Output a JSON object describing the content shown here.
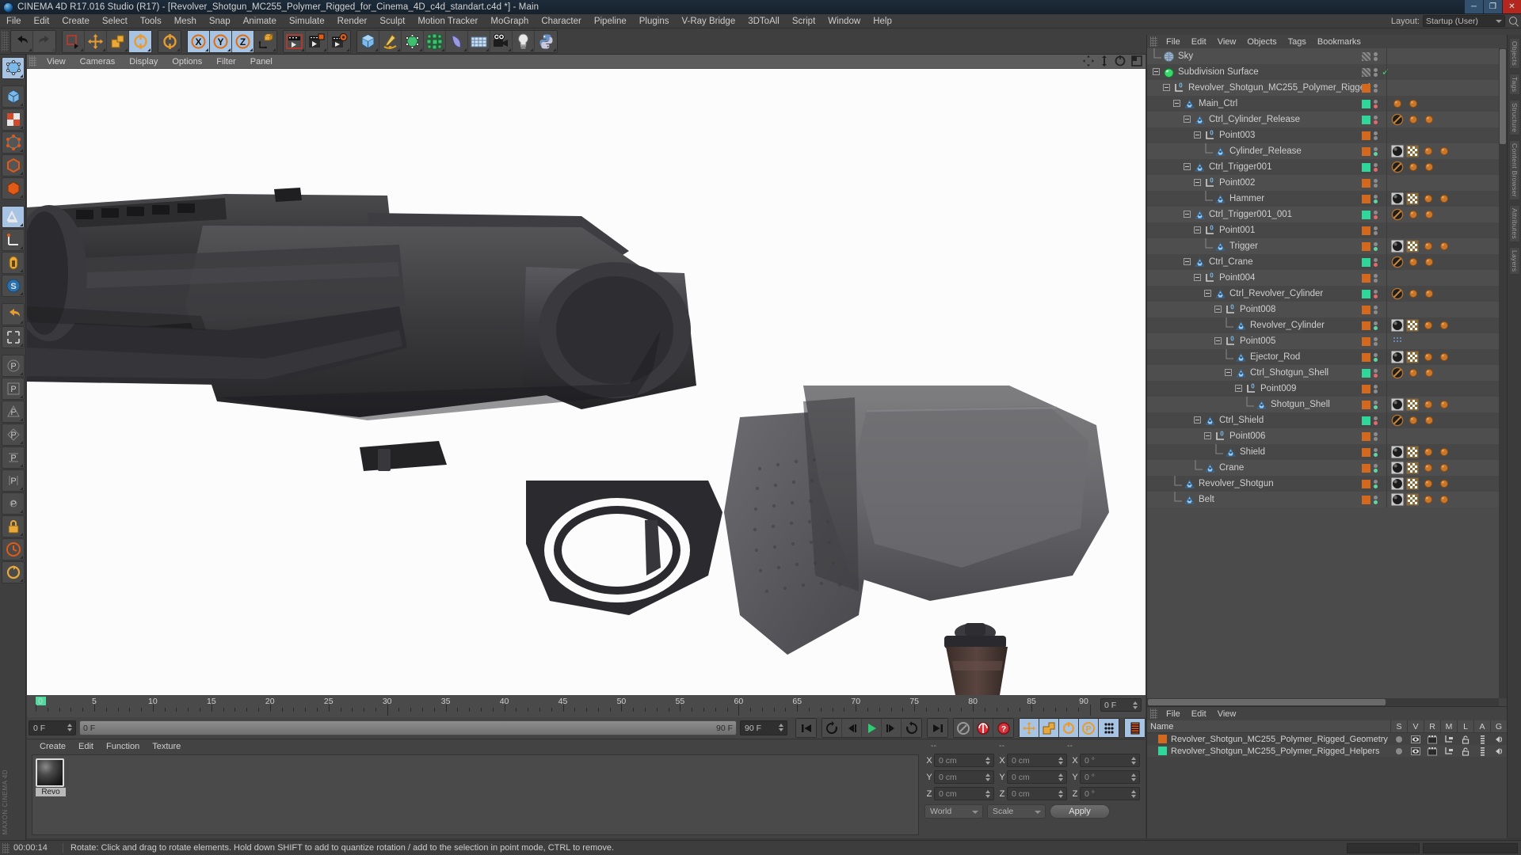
{
  "window": {
    "title": "CINEMA 4D R17.016 Studio (R17) - [Revolver_Shotgun_MC255_Polymer_Rigged_for_Cinema_4D_c4d_standart.c4d *] - Main",
    "minimize": "─",
    "maximize": "❐",
    "close": "✕"
  },
  "menubar": {
    "items": [
      "File",
      "Edit",
      "Create",
      "Select",
      "Tools",
      "Mesh",
      "Snap",
      "Animate",
      "Simulate",
      "Render",
      "Sculpt",
      "Motion Tracker",
      "MoGraph",
      "Character",
      "Pipeline",
      "Plugins",
      "V-Ray Bridge",
      "3DToAll",
      "Script",
      "Window",
      "Help"
    ],
    "layout_label": "Layout:",
    "layout_value": "Startup (User)"
  },
  "toolbar": {
    "groups": [
      {
        "buttons": [
          {
            "name": "undo-button",
            "icon": "undo",
            "state": "normal"
          },
          {
            "name": "redo-button",
            "icon": "redo",
            "state": "dim"
          }
        ]
      },
      {
        "buttons": [
          {
            "name": "live-selection-button",
            "icon": "select",
            "state": "normal"
          },
          {
            "name": "move-button",
            "icon": "move",
            "state": "normal"
          },
          {
            "name": "scale-button",
            "icon": "scale",
            "state": "normal"
          },
          {
            "name": "rotate-button",
            "icon": "rotate",
            "state": "active"
          }
        ]
      },
      {
        "buttons": [
          {
            "name": "rotate-alt-button",
            "icon": "rotate",
            "state": "normal"
          }
        ]
      },
      {
        "buttons": [
          {
            "name": "x-axis-lock-button",
            "icon": "x",
            "state": "active"
          },
          {
            "name": "y-axis-lock-button",
            "icon": "y",
            "state": "active"
          },
          {
            "name": "z-axis-lock-button",
            "icon": "z",
            "state": "active"
          },
          {
            "name": "world-object-coord-button",
            "icon": "world",
            "state": "normal"
          }
        ]
      },
      {
        "buttons": [
          {
            "name": "render-view-button",
            "icon": "render-view",
            "state": "normal"
          },
          {
            "name": "render-region-button",
            "icon": "render-region",
            "state": "normal"
          },
          {
            "name": "render-settings-button",
            "icon": "render-settings",
            "state": "normal"
          }
        ]
      },
      {
        "buttons": [
          {
            "name": "add-cube-button",
            "icon": "cube",
            "state": "normal"
          },
          {
            "name": "add-spline-button",
            "icon": "spline",
            "state": "normal"
          },
          {
            "name": "add-nurbs-button",
            "icon": "nurbs",
            "state": "normal"
          },
          {
            "name": "add-array-button",
            "icon": "array",
            "state": "normal"
          },
          {
            "name": "add-bend-button",
            "icon": "bend",
            "state": "normal"
          },
          {
            "name": "add-floor-button",
            "icon": "floor",
            "state": "normal"
          },
          {
            "name": "add-camera-button",
            "icon": "camera",
            "state": "normal"
          },
          {
            "name": "add-light-button",
            "icon": "light",
            "state": "normal"
          },
          {
            "name": "python-button",
            "icon": "python",
            "state": "normal"
          }
        ]
      }
    ]
  },
  "lefttoolbar": {
    "buttons": [
      {
        "name": "make-editable-button",
        "icon": "editable"
      },
      {
        "name": "model-mode-button",
        "icon": "model"
      },
      {
        "name": "texture-mode-button",
        "icon": "texture"
      },
      {
        "name": "points-mode-button",
        "icon": "points"
      },
      {
        "name": "edges-mode-button",
        "icon": "edges"
      },
      {
        "name": "polygons-mode-button",
        "icon": "polygons"
      },
      {
        "name": "viewport-solo-button",
        "icon": "viewport-solo"
      },
      {
        "name": "enable-axis-button",
        "icon": "axis-lock"
      },
      {
        "name": "enable-snap-button",
        "icon": "snap"
      },
      {
        "name": "workplane-button",
        "icon": "workplane"
      },
      {
        "name": "undo-view-button",
        "icon": "undo-view"
      },
      {
        "name": "frame-scene-button",
        "icon": "frame"
      },
      {
        "name": "point-mode-p-button",
        "icon": "p1"
      },
      {
        "name": "point-mode-p2-button",
        "icon": "p2"
      },
      {
        "name": "point-mode-p3-button",
        "icon": "p3"
      },
      {
        "name": "point-mode-p4-button",
        "icon": "p4"
      },
      {
        "name": "point-mode-p5-button",
        "icon": "p5"
      },
      {
        "name": "point-mode-p6-button",
        "icon": "p6"
      },
      {
        "name": "point-mode-p7-button",
        "icon": "p7"
      },
      {
        "name": "lock-button",
        "icon": "lock"
      },
      {
        "name": "clock-button",
        "icon": "clock"
      },
      {
        "name": "cycle-button",
        "icon": "cycle"
      }
    ],
    "brand": "MAXON CINEMA 4D"
  },
  "viewport": {
    "menu": [
      "View",
      "Cameras",
      "Display",
      "Options",
      "Filter",
      "Panel"
    ],
    "icons": [
      "pan-icon",
      "zoom-icon",
      "rotate-icon",
      "maximize-view-icon"
    ]
  },
  "timeline": {
    "tick_labels": [
      "0",
      "5",
      "10",
      "15",
      "20",
      "25",
      "30",
      "35",
      "40",
      "45",
      "50",
      "55",
      "60",
      "65",
      "70",
      "75",
      "80",
      "85",
      "90"
    ],
    "min": 0,
    "max": 90,
    "current_frame": "0 F",
    "current_frame_right": "0 F"
  },
  "animbar": {
    "start_frame": "0 F",
    "scrub_left": "0 F",
    "scrub_right": "90 F",
    "end_frame": "90 F",
    "buttons": [
      {
        "name": "go-to-start-button",
        "icon": "skip-back"
      },
      {
        "name": "play-reverse-button",
        "icon": "rewind-loop"
      },
      {
        "name": "prev-frame-button",
        "icon": "step-back"
      },
      {
        "name": "play-button",
        "icon": "play"
      },
      {
        "name": "next-frame-button",
        "icon": "step-fwd"
      },
      {
        "name": "play-forward-loop-button",
        "icon": "fwd-loop"
      },
      {
        "name": "go-to-end-button",
        "icon": "skip-fwd"
      },
      {
        "name": "record-active-objects-button",
        "icon": "record-key"
      },
      {
        "name": "autokeying-button",
        "icon": "autokey"
      },
      {
        "name": "keyframe-selection-button",
        "icon": "keyframe-select"
      },
      {
        "name": "position-key-button",
        "icon": "pos-key"
      },
      {
        "name": "scale-key-button",
        "icon": "scale-key"
      },
      {
        "name": "rotation-key-button",
        "icon": "rot-key"
      },
      {
        "name": "param-key-button",
        "icon": "param-key"
      },
      {
        "name": "point-level-anim-button",
        "icon": "pla-key"
      },
      {
        "name": "timeline-toggle-button",
        "icon": "timeline"
      }
    ]
  },
  "material_manager": {
    "menu": [
      "Create",
      "Edit",
      "Function",
      "Texture"
    ],
    "materials": [
      {
        "name": "Revo",
        "label": "Revo"
      }
    ]
  },
  "coordinates": {
    "headers": [
      "--",
      "--",
      "--"
    ],
    "rows": [
      {
        "axis": "X",
        "position": "0 cm",
        "size": "0 cm",
        "rotation": "0 °"
      },
      {
        "axis": "Y",
        "position": "0 cm",
        "size": "0 cm",
        "rotation": "0 °"
      },
      {
        "axis": "Z",
        "position": "0 cm",
        "size": "0 cm",
        "rotation": "0 °"
      }
    ],
    "coord_system": "World",
    "mode": "Scale",
    "apply_label": "Apply"
  },
  "object_manager": {
    "menu": [
      "File",
      "Edit",
      "View",
      "Objects",
      "Tags",
      "Bookmarks"
    ],
    "items": [
      {
        "label": "Sky",
        "depth": 0,
        "icon": "sky",
        "expander": "none",
        "swatch": "hatched",
        "dots": [
          "grey",
          "grey"
        ],
        "tags": []
      },
      {
        "label": "Subdivision Surface",
        "depth": 0,
        "icon": "subdiv",
        "expander": "open",
        "swatch": "hatched",
        "dots": [
          "grey",
          "grey"
        ],
        "check": true,
        "tags": []
      },
      {
        "label": "Revolver_Shotgun_MC255_Polymer_Rigged",
        "depth": 1,
        "icon": "null-layer",
        "expander": "open",
        "swatch": "orange",
        "dots": [
          "grey",
          "grey"
        ],
        "tags": []
      },
      {
        "label": "Main_Ctrl",
        "depth": 2,
        "icon": "joint",
        "expander": "open",
        "swatch": "green",
        "dots": [
          "grey",
          "red"
        ],
        "tags": [
          "sphere-orange",
          "sphere-orange"
        ]
      },
      {
        "label": "Ctrl_Cylinder_Release",
        "depth": 3,
        "icon": "joint",
        "expander": "open",
        "swatch": "green",
        "dots": [
          "grey",
          "red"
        ],
        "tags": [
          "protect",
          "sphere-orange",
          "sphere-orange"
        ]
      },
      {
        "label": "Point003",
        "depth": 4,
        "icon": "null-layer",
        "expander": "open",
        "swatch": "orange",
        "dots": [
          "grey",
          "grey"
        ],
        "tags": []
      },
      {
        "label": "Cylinder_Release",
        "depth": 5,
        "icon": "joint",
        "expander": "none",
        "swatch": "orange",
        "dots": [
          "grey",
          "green"
        ],
        "tags": [
          "material",
          "checker",
          "sphere-orange",
          "sphere-orange"
        ]
      },
      {
        "label": "Ctrl_Trigger001",
        "depth": 3,
        "icon": "joint",
        "expander": "open",
        "swatch": "green",
        "dots": [
          "grey",
          "red"
        ],
        "tags": [
          "protect",
          "sphere-orange",
          "sphere-orange"
        ]
      },
      {
        "label": "Point002",
        "depth": 4,
        "icon": "null-layer",
        "expander": "open",
        "swatch": "orange",
        "dots": [
          "grey",
          "grey"
        ],
        "tags": []
      },
      {
        "label": "Hammer",
        "depth": 5,
        "icon": "joint",
        "expander": "none",
        "swatch": "orange",
        "dots": [
          "grey",
          "green"
        ],
        "tags": [
          "material",
          "checker",
          "sphere-orange",
          "sphere-orange"
        ]
      },
      {
        "label": "Ctrl_Trigger001_001",
        "depth": 3,
        "icon": "joint",
        "expander": "open",
        "swatch": "green",
        "dots": [
          "grey",
          "red"
        ],
        "tags": [
          "protect",
          "sphere-orange",
          "sphere-orange"
        ]
      },
      {
        "label": "Point001",
        "depth": 4,
        "icon": "null-layer",
        "expander": "open",
        "swatch": "orange",
        "dots": [
          "grey",
          "grey"
        ],
        "tags": []
      },
      {
        "label": "Trigger",
        "depth": 5,
        "icon": "joint",
        "expander": "none",
        "swatch": "orange",
        "dots": [
          "grey",
          "green"
        ],
        "tags": [
          "material",
          "checker",
          "sphere-orange",
          "sphere-orange"
        ]
      },
      {
        "label": "Ctrl_Crane",
        "depth": 3,
        "icon": "joint",
        "expander": "open",
        "swatch": "green",
        "dots": [
          "grey",
          "red"
        ],
        "tags": [
          "protect",
          "sphere-orange",
          "sphere-orange"
        ]
      },
      {
        "label": "Point004",
        "depth": 4,
        "icon": "null-layer",
        "expander": "open",
        "swatch": "orange",
        "dots": [
          "grey",
          "grey"
        ],
        "tags": []
      },
      {
        "label": "Ctrl_Revolver_Cylinder",
        "depth": 5,
        "icon": "joint",
        "expander": "open",
        "swatch": "green",
        "dots": [
          "grey",
          "red"
        ],
        "tags": [
          "protect",
          "sphere-orange",
          "sphere-orange"
        ]
      },
      {
        "label": "Point008",
        "depth": 6,
        "icon": "null-layer",
        "expander": "open",
        "swatch": "orange",
        "dots": [
          "grey",
          "grey"
        ],
        "tags": []
      },
      {
        "label": "Revolver_Cylinder",
        "depth": 7,
        "icon": "joint",
        "expander": "none",
        "swatch": "orange",
        "dots": [
          "grey",
          "green"
        ],
        "tags": [
          "material",
          "checker",
          "sphere-orange",
          "sphere-orange"
        ]
      },
      {
        "label": "Point005",
        "depth": 6,
        "icon": "null-layer",
        "expander": "open",
        "swatch": "orange",
        "dots": [
          "grey",
          "grey"
        ],
        "tags": [
          "dotted"
        ]
      },
      {
        "label": "Ejector_Rod",
        "depth": 7,
        "icon": "joint",
        "expander": "none",
        "swatch": "orange",
        "dots": [
          "grey",
          "green"
        ],
        "tags": [
          "material",
          "checker",
          "sphere-orange",
          "sphere-orange"
        ]
      },
      {
        "label": "Ctrl_Shotgun_Shell",
        "depth": 7,
        "icon": "joint",
        "expander": "open",
        "swatch": "green",
        "dots": [
          "grey",
          "red"
        ],
        "tags": [
          "protect",
          "sphere-orange",
          "sphere-orange"
        ]
      },
      {
        "label": "Point009",
        "depth": 8,
        "icon": "null-layer",
        "expander": "open",
        "swatch": "orange",
        "dots": [
          "grey",
          "grey"
        ],
        "tags": []
      },
      {
        "label": "Shotgun_Shell",
        "depth": 9,
        "icon": "joint",
        "expander": "none",
        "swatch": "orange",
        "dots": [
          "grey",
          "green"
        ],
        "tags": [
          "material",
          "checker",
          "sphere-orange",
          "sphere-orange"
        ]
      },
      {
        "label": "Ctrl_Shield",
        "depth": 4,
        "icon": "joint",
        "expander": "open",
        "swatch": "green",
        "dots": [
          "grey",
          "red"
        ],
        "tags": [
          "protect",
          "sphere-orange",
          "sphere-orange"
        ]
      },
      {
        "label": "Point006",
        "depth": 5,
        "icon": "null-layer",
        "expander": "open",
        "swatch": "orange",
        "dots": [
          "grey",
          "grey"
        ],
        "tags": []
      },
      {
        "label": "Shield",
        "depth": 6,
        "icon": "joint",
        "expander": "none",
        "swatch": "orange",
        "dots": [
          "grey",
          "green"
        ],
        "tags": [
          "material",
          "checker",
          "sphere-orange",
          "sphere-orange"
        ]
      },
      {
        "label": "Crane",
        "depth": 4,
        "icon": "joint",
        "expander": "none",
        "swatch": "orange",
        "dots": [
          "grey",
          "green"
        ],
        "tags": [
          "material",
          "checker",
          "sphere-orange",
          "sphere-orange"
        ]
      },
      {
        "label": "Revolver_Shotgun",
        "depth": 2,
        "icon": "joint",
        "expander": "none",
        "swatch": "orange",
        "dots": [
          "grey",
          "green"
        ],
        "tags": [
          "material",
          "checker",
          "sphere-orange",
          "sphere-orange"
        ]
      },
      {
        "label": "Belt",
        "depth": 2,
        "icon": "joint",
        "expander": "none",
        "swatch": "orange",
        "dots": [
          "grey",
          "green"
        ],
        "tags": [
          "material",
          "checker",
          "sphere-orange",
          "sphere-orange"
        ]
      }
    ]
  },
  "layer_manager": {
    "menu": [
      "File",
      "Edit",
      "View"
    ],
    "columns": [
      "Name",
      "S",
      "V",
      "R",
      "M",
      "L",
      "A",
      "G"
    ],
    "rows": [
      {
        "label": "Revolver_Shotgun_MC255_Polymer_Rigged_Geometry",
        "color": "#d2691e"
      },
      {
        "label": "Revolver_Shotgun_MC255_Polymer_Rigged_Helpers",
        "color": "#31d79a"
      }
    ]
  },
  "edge_tabs": [
    "Objects",
    "Tags",
    "Structure",
    "Content Browser",
    "Attributes",
    "Layers"
  ],
  "status": {
    "time": "00:00:14",
    "message": "Rotate: Click and drag to rotate elements. Hold down SHIFT to add to quantize rotation / add to the selection in point mode, CTRL to remove."
  },
  "colors": {
    "accent_orange": "#d2691e",
    "accent_green": "#31d79a",
    "active_blue": "#a8c4e4",
    "panel_bg": "#434343",
    "row_bg": "#4e4e4e"
  }
}
